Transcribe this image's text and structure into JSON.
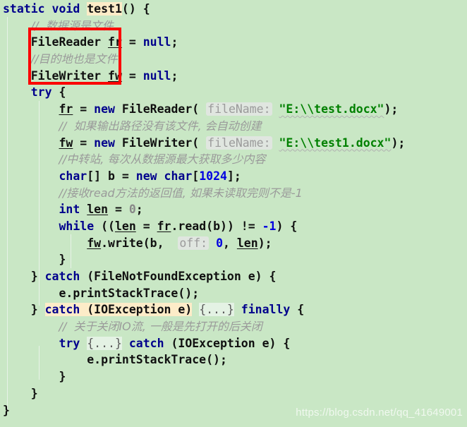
{
  "editor": {
    "background_color": "#c9e7c5",
    "language": "Java",
    "watermark": "https://blog.csdn.net/qq_41649001"
  },
  "colors": {
    "background": "#c9e7c5",
    "keyword": "#00008c",
    "string": "#008000",
    "number": "#0000e0",
    "comment": "#9a9a9a",
    "plain": "#101010",
    "identifier_highlight": "#fdecc8",
    "folded_chip": "#e4f2e4",
    "param_hint_bg": "#e0e6e0",
    "param_hint_text": "#9b9b9b",
    "annotation_box": "#fb0000",
    "indent_guide": "#e8f2e8"
  },
  "annotation": {
    "type": "red-rectangle",
    "encloses": [
      "FileReader fr = null;",
      "FileWriter fw = null;"
    ]
  },
  "code": {
    "line01": {
      "kw1": "static",
      "kw2": "void",
      "name": "test1",
      "tail": "() {"
    },
    "line02": {
      "comment": "//  数据源是文件"
    },
    "line03": {
      "type": "FileReader",
      "var": "fr",
      "eq": " = ",
      "kw": "null",
      "semi": ";"
    },
    "line04": {
      "comment": "//目的地也是文件"
    },
    "line05": {
      "type": "FileWriter",
      "var": "fw",
      "eq": " = ",
      "kw": "null",
      "semi": ";"
    },
    "line06": {
      "kw": "try",
      "brace": " {"
    },
    "line07": {
      "var": "fr",
      "eq": " = ",
      "kw": "new",
      "ctor": " FileReader(",
      "hint": "fileName:",
      "str": "\"E:\\\\test.docx\"",
      "tail": ");"
    },
    "line08": {
      "comment": "//  如果输出路径没有该文件, 会自动创建"
    },
    "line09": {
      "var": "fw",
      "eq": " = ",
      "kw": "new",
      "ctor": " FileWriter(",
      "hint": "fileName:",
      "str": "\"E:\\\\test1.docx\"",
      "tail": ");"
    },
    "line10": {
      "comment": "//中转站, 每次从数据源最大获取多少内容"
    },
    "line11": {
      "kw1": "char",
      "arr": "[] b = ",
      "kw2": "new",
      "kw3": " char",
      "lb": "[",
      "num": "1024",
      "rb": "];"
    },
    "line12": {
      "comment": "//接收read方法的返回值, 如果未读取完则不是-1"
    },
    "line13": {
      "kw": "int",
      "sp": " ",
      "var": "len",
      "eq": " = ",
      "num": "0",
      "semi": ";"
    },
    "line14": {
      "kw": "while",
      "open": " ((",
      "var1": "len",
      "eq": " = ",
      "var2": "fr",
      "call": ".read(b)) != ",
      "num": "-1",
      "tail": ") {"
    },
    "line15": {
      "var1": "fw",
      "call": ".write(b, ",
      "hint": "off:",
      "num": "0",
      "comma": ", ",
      "var2": "len",
      "tail": ");"
    },
    "line16": {
      "brace": "}"
    },
    "line17": {
      "close": "} ",
      "kw": "catch",
      "rest": " (FileNotFoundException e) {"
    },
    "line18": {
      "stmt": "e.printStackTrace();"
    },
    "line19": {
      "close": "} ",
      "kw": "catch",
      "exc": " (IOException e)",
      "fold": "{...}",
      "kw2": "finally",
      "brace": " {"
    },
    "line20": {
      "comment": "//  关于关闭IO流, 一般是先打开的后关闭"
    },
    "line21": {
      "kw": "try",
      "fold": "{...}",
      "kw2": "catch",
      "rest": " (IOException e) {"
    },
    "line22": {
      "stmt": "e.printStackTrace();"
    },
    "line23": {
      "brace": "}"
    },
    "line24": {
      "brace": "}"
    },
    "line25": {
      "brace": "}"
    }
  }
}
